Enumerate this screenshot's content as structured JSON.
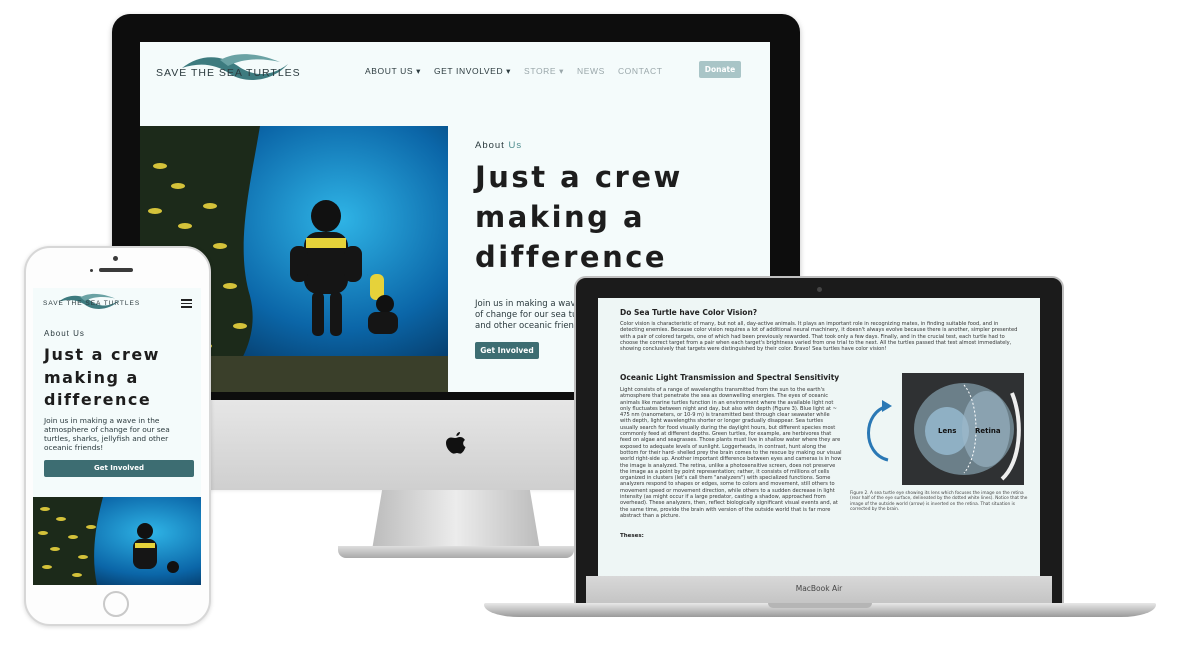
{
  "brand": {
    "name": "SAVE THE SEA TURTLES",
    "color": "#3d7b7f",
    "button_color": "#3d6d72"
  },
  "desktop": {
    "nav": [
      {
        "label": "ABOUT US",
        "caret": "▾"
      },
      {
        "label": "GET INVOLVED",
        "caret": "▾"
      },
      {
        "label": "STORE",
        "caret": "▾"
      },
      {
        "label": "NEWS",
        "caret": ""
      },
      {
        "label": "CONTACT",
        "caret": ""
      }
    ],
    "donate_label": "Donate"
  },
  "hero": {
    "eyebrow": "About",
    "eyebrow_accent": "Us",
    "headline_lines": [
      "Just a crew",
      "making a",
      "difference"
    ],
    "desktop_intro_lines": [
      "Join us in making a wave",
      "of change for our sea tu",
      "and other oceanic frien"
    ],
    "intro": "Join us in making a wave in the atmosphere of change for our sea turtles, sharks, jellyfish and other oceanic friends!",
    "cta_label": "Get Involved"
  },
  "laptop": {
    "model": "MacBook Air",
    "article": {
      "section1_title": "Do Sea Turtle have Color Vision?",
      "section1_body": "Color vision is characteristic of many, but not all, day-active animals. It plays an important role in recognizing mates, in finding suitable food, and in detecting enemies. Because color vision requires a lot of additional neural machinery, it doesn't always evolve because there is another, simpler presented with a pair of colored targets, one of which had been previously rewarded. That took only a few days. Finally, and in the crucial test, each turtle had to choose the correct target from a pair when each target's brightness varied from one trial to the next. All the turtles passed that test almost immediately, showing conclusively that targets were distinguished by their color. Bravo! Sea turtles have color vision!",
      "section2_title": "Oceanic Light Transmission and Spectral Sensitivity",
      "section2_body": "Light consists of a range of wavelengths transmitted from the sun to the earth's atmosphere that penetrate the sea as downwelling energies. The eyes of oceanic animals like marine turtles function in an environment where the available light not only fluctuates between night and day, but also with depth (Figure 3). Blue light at ~ 475 nm (nanometers, or 10-9 m) is transmitted best through clear seawater while with depth, light wavelengths shorter or longer gradually disappear. Sea turtles usually search for food visually during the daylight hours, but different species most commonly feed at different depths. Green turtles, for example, are herbivores that feed on algae and seagrasses. Those plants must live in shallow water where they are exposed to adequate levels of sunlight. Loggerheads, in contrast, hunt along the bottom for their hard- shelled prey the brain comes to the rescue by making our visual world right-side up. Another important difference between eyes and cameras is in how the image is analyzed. The retina, unlike a photosensitive screen, does not preserve the image as a point by point representation; rather, it consists of millions of cells organized in clusters (let's call them \"analyzers\") with specialized functions. Some analyzers respond to shapes or edges, some to colors and movement, still others to movement speed or movement direction, while others to a sudden decrease in light intensity (as might occur if a large predator, casting a shadow, approached from overhead). These analyzers, then, reflect biologically significant visual events and, at the same time, provide the brain with version of the outside world that is far more abstract than a picture.",
      "figure_lens": "Lens",
      "figure_retina": "Retina",
      "figure_caption": "Figure 2. A sea turtle eye showing its lens which focuses the image on the retina (rear half of the eye surface, delineated by the dotted white lines). Notice that the image of the outside world (arrow) is inverted on the retina. That situation is corrected by the brain.",
      "section3_title": "Theses:"
    }
  }
}
